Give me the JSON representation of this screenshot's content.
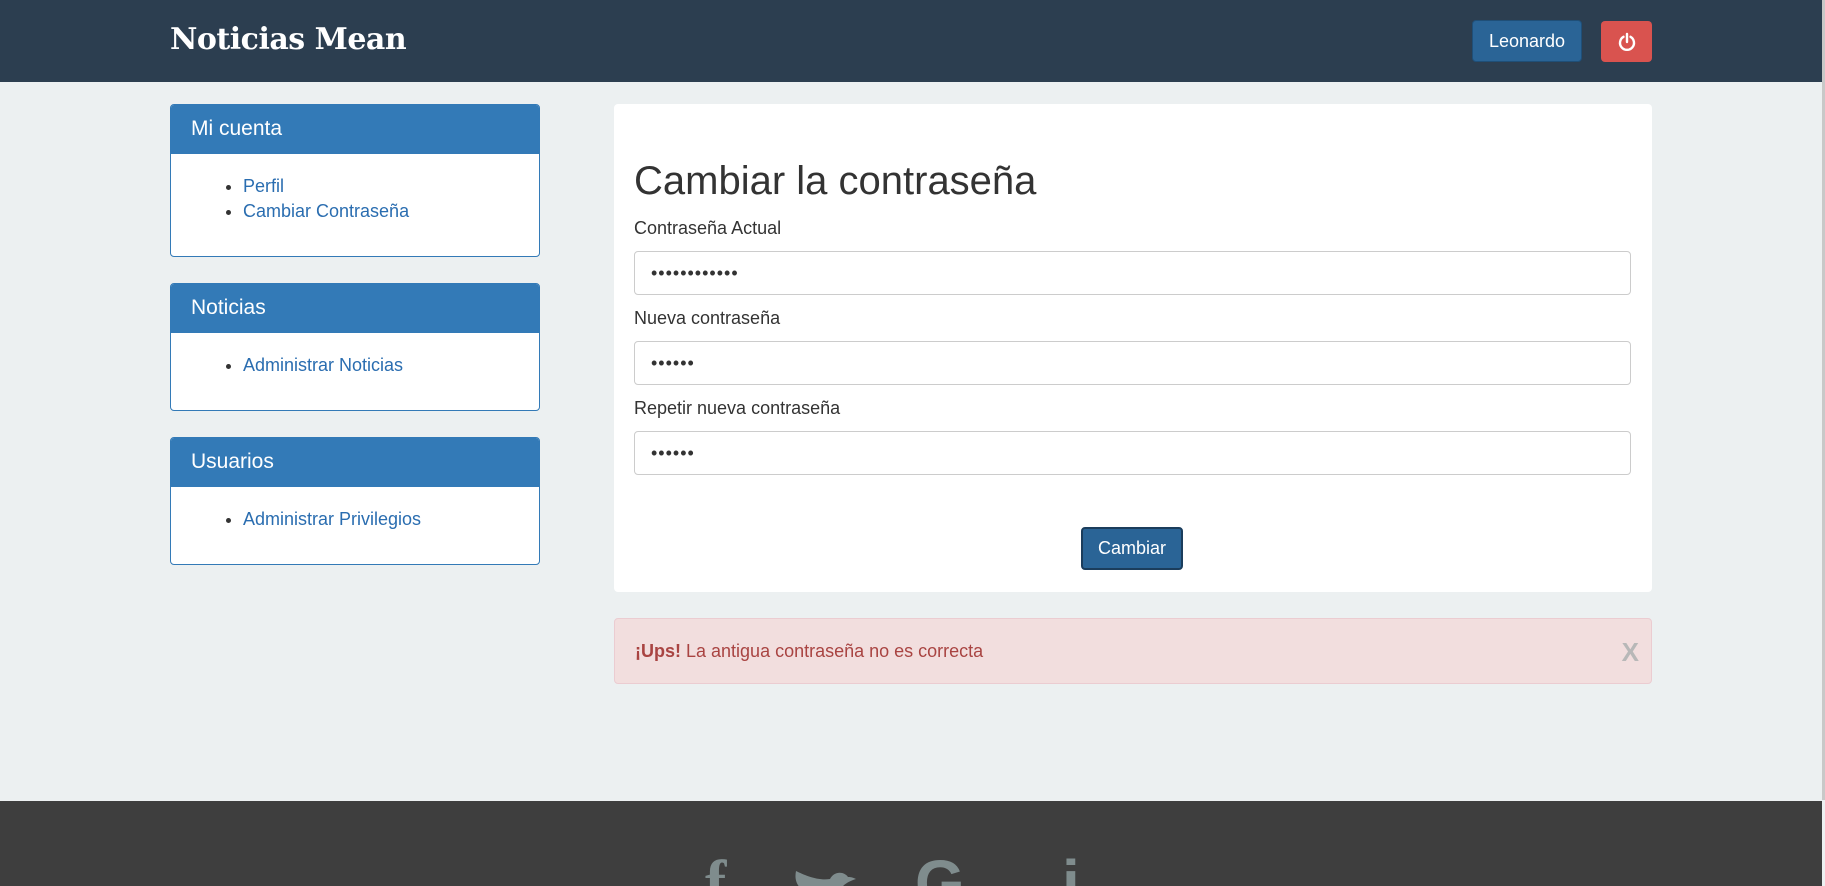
{
  "navbar": {
    "brand": "Noticias Mean",
    "user_label": "Leonardo",
    "logout_icon": "power-icon"
  },
  "sidebar": {
    "panels": [
      {
        "title": "Mi cuenta",
        "items": [
          "Perfil",
          "Cambiar Contraseña"
        ]
      },
      {
        "title": "Noticias",
        "items": [
          "Administrar Noticias"
        ]
      },
      {
        "title": "Usuarios",
        "items": [
          "Administrar Privilegios"
        ]
      }
    ]
  },
  "form": {
    "title": "Cambiar la contraseña",
    "current_label": "Contraseña Actual",
    "current_value": "••••••••••••",
    "new_label": "Nueva contraseña",
    "new_value": "••••••",
    "repeat_label": "Repetir nueva contraseña",
    "repeat_value": "••••••",
    "submit_label": "Cambiar"
  },
  "alert": {
    "strong": "¡Ups!",
    "message": " La antigua contraseña no es correcta",
    "close_label": "X"
  },
  "footer": {
    "icons": [
      "facebook-icon",
      "twitter-icon",
      "google-icon",
      "instagram-icon"
    ]
  },
  "colors": {
    "navbar": "#2c3e50",
    "primary": "#337ab7",
    "danger": "#d9534f",
    "alert_bg": "#f2dede",
    "alert_text": "#a94442",
    "footer": "#3e3e3e"
  }
}
